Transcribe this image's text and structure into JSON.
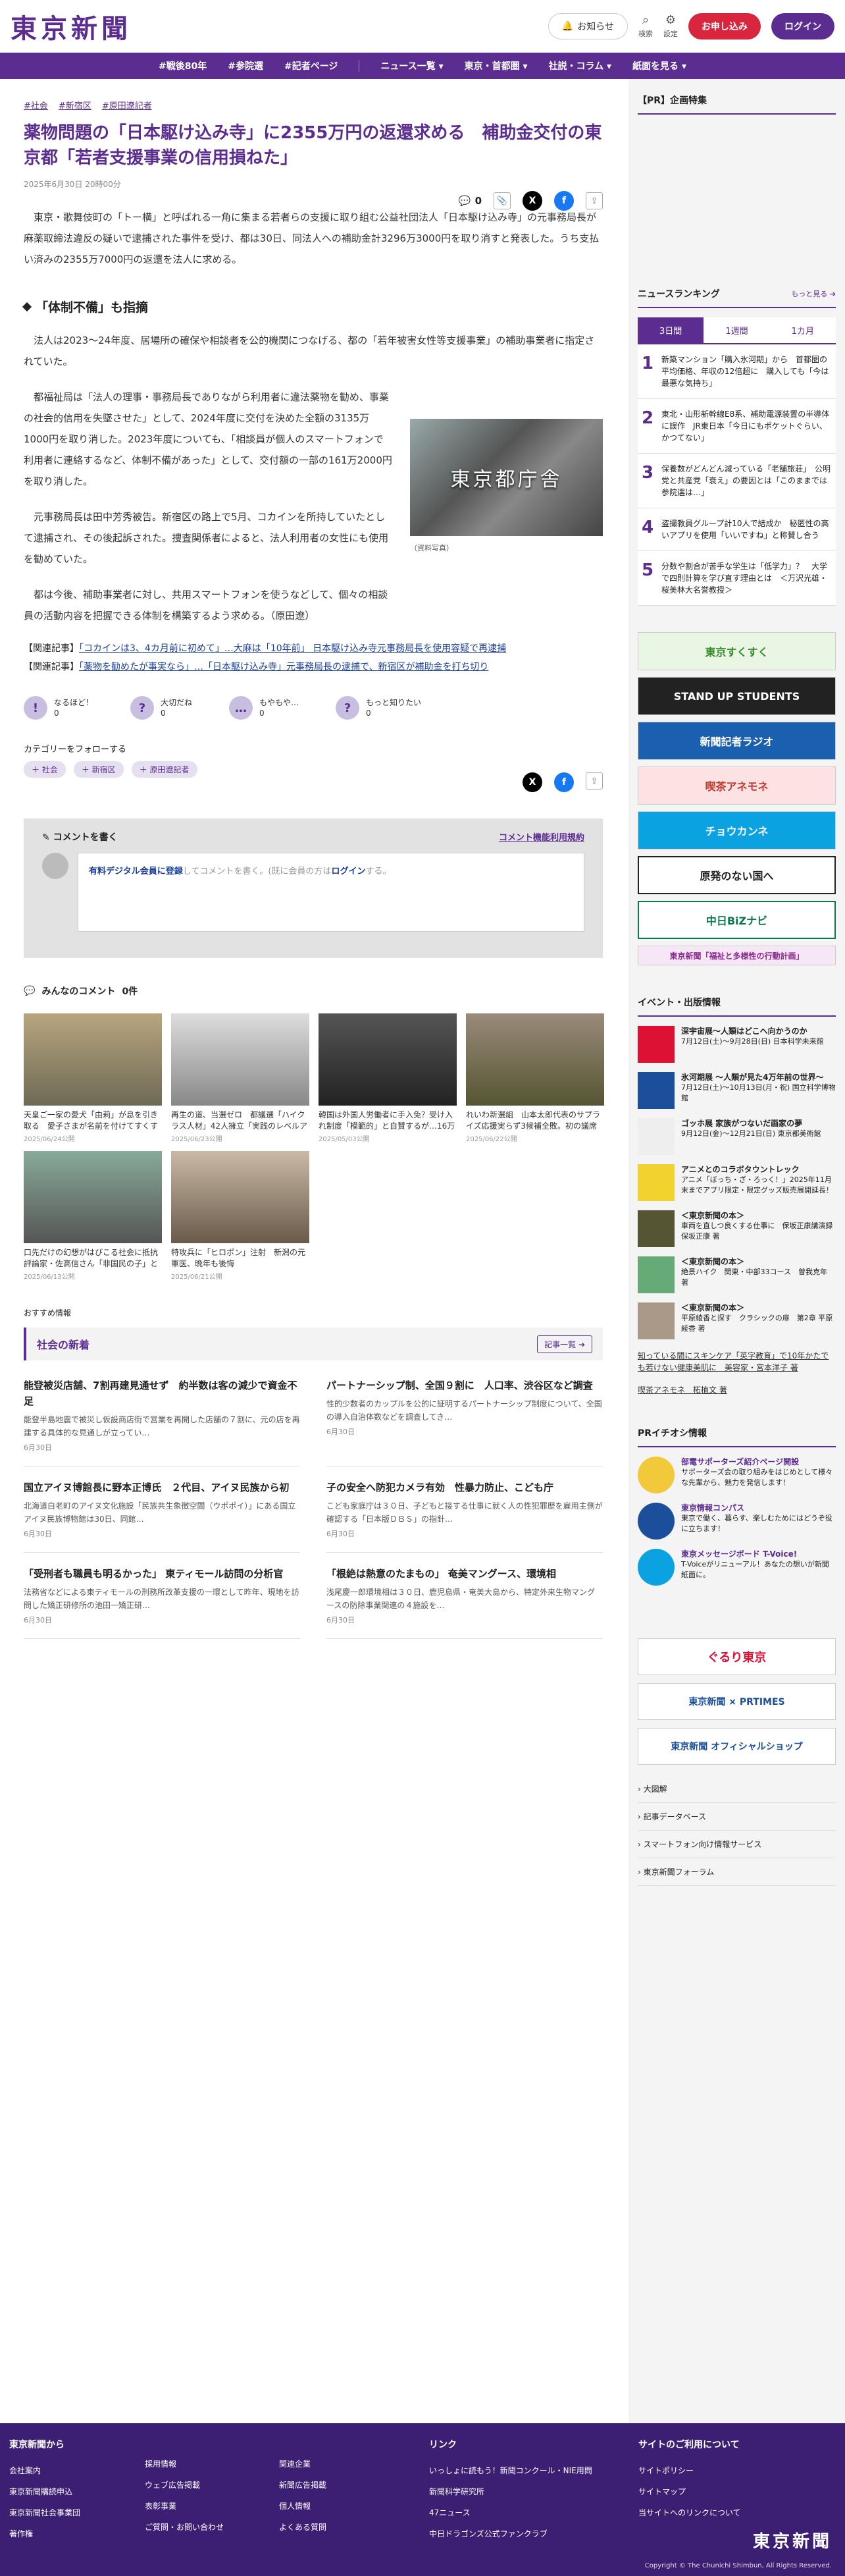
{
  "header": {
    "logo": "東京新聞",
    "notice": "お知らせ",
    "search": "検索",
    "settings": "設定",
    "register": "お申し込み",
    "login": "ログイン"
  },
  "nav": [
    "#戦後80年",
    "#参院選",
    "#記者ページ",
    "ニュース一覧",
    "東京・首都圏",
    "社説・コラム",
    "紙面を見る"
  ],
  "article": {
    "tags": [
      "#社会",
      "#新宿区",
      "#原田遼記者"
    ],
    "title": "薬物問題の「日本駆け込み寺」に2355万円の返還求める　補助金交付の東京都「若者支援事業の信用損ねた」",
    "date": "2025年6月30日 20時00分",
    "comment_count": "0",
    "p1": "東京・歌舞伎町の「トー横」と呼ばれる一角に集まる若者らの支援に取り組む公益社団法人「日本駆け込み寺」の元事務局長が麻薬取締法違反の疑いで逮捕された事件を受け、都は30日、同法人への補助金計3296万3000円を取り消すと発表した。うち支払い済みの2355万7000円の返還を法人に求める。",
    "sub": "「体制不備」も指摘",
    "p2": "法人は2023〜24年度、居場所の確保や相談者を公的機関につなげる、都の「若年被害女性等支援事業」の補助事業者に指定されていた。",
    "p3": "都福祉局は「法人の理事・事務局長でありながら利用者に違法薬物を勧め、事業の社会的信用を失墜させた」として、2024年度に交付を決めた全額の3135万1000円を取り消した。2023年度についても、「相談員が個人のスマートフォンで利用者に連絡するなど、体制不備があった」として、交付額の一部の161万2000円を取り消した。",
    "p4": "元事務局長は田中芳秀被告。新宿区の路上で5月、コカインを所持していたとして逮捕され、その後起訴された。捜査関係者によると、法人利用者の女性にも使用を勧めていた。",
    "p5": "都は今後、補助事業者に対し、共用スマートフォンを使うなどして、個々の相談員の活動内容を把握できる体制を構築するよう求める。（原田遼）",
    "fig_text": "東京都庁舎",
    "fig_caption": "（資料写真）",
    "rel_label": "【関連記事】",
    "rel1": "「コカインは3、4カ月前に初めて」…大麻は「10年前」 日本駆け込み寺元事務局長を使用容疑で再逮捕",
    "rel2": "「薬物を勧めたが事実なら」…「日本駆け込み寺」元事務局長の逮捕で、新宿区が補助金を打ち切り",
    "reactions": [
      {
        "icon": "!",
        "label": "なるほど！",
        "count": "0"
      },
      {
        "icon": "?",
        "label": "大切だね",
        "count": "0"
      },
      {
        "icon": "…",
        "label": "もやもや…",
        "count": "0"
      },
      {
        "icon": "?",
        "label": "もっと知りたい",
        "count": "0"
      }
    ],
    "follow_label": "カテゴリーをフォローする",
    "follow_tags": [
      "社会",
      "新宿区",
      "原田遼記者"
    ]
  },
  "comments": {
    "write": "コメントを書く",
    "rules": "コメント機能利用規約",
    "cta_pre": "有料デジタル会員に登録",
    "cta_mid": "してコメントを書く。(既に会員の方は",
    "cta_login": "ログイン",
    "cta_post": "する。",
    "all": "みんなのコメント",
    "count": "0件"
  },
  "cards": [
    {
      "t": "天皇ご一家の愛犬「由莉」が息を引き取る　愛子さまが名前を付けてすくすくと…16歳",
      "d": "2025/06/24公開"
    },
    {
      "t": "再生の道、当選ゼロ　都議選「ハイクラス人材」42人擁立「実践のレベルアップ手塚な…",
      "d": "2025/06/23公開"
    },
    {
      "t": "韓国は外国人労働者に手入免？受け入れ制度「模範的」と自賛するが…16万5000人の枠が手…",
      "d": "2025/05/03公開"
    },
    {
      "t": "れいわ新選組　山本太郎代表のサプライズ応援実らず3候補全敗。初の議席獲得ならず　東…",
      "d": "2025/06/22公開"
    },
    {
      "t": "口先だけの幻想がはびこる社会に抵抗　評論家・佐高信さん「非国民の子」として　利益…",
      "d": "2025/06/13公開"
    },
    {
      "t": "特攻兵に「ヒロポン」注射　新潟の元軍医、晩年も後悔",
      "d": "2025/06/21公開"
    }
  ],
  "recommend": "おすすめ情報",
  "social": {
    "title": "社会の新着",
    "more": "記事一覧",
    "items": [
      {
        "h": "能登被災店舗、7割再建見通せず　約半数は客の減少で資金不足",
        "s": "能登半島地震で被災し仮設商店街で営業を再開した店舗の７割に、元の店を再建する具体的な見通しが立ってい…",
        "d": "6月30日"
      },
      {
        "h": "パートナーシップ制、全国９割に　人口率、渋谷区など調査",
        "s": "性的少数者のカップルを公的に証明するパートナーシップ制度について、全国の導入自治体数などを調査してき…",
        "d": "6月30日"
      },
      {
        "h": "国立アイヌ博館長に野本正博氏　２代目、アイヌ民族から初",
        "s": "北海道白老町のアイヌ文化施設「民族共生象徴空間（ウポポイ）」にある国立アイヌ民族博物館は30日、同館…",
        "d": "6月30日"
      },
      {
        "h": "子の安全へ防犯カメラ有効　性暴力防止、こども庁",
        "s": "こども家庭庁は３０日、子どもと接する仕事に就く人の性犯罪歴を雇用主側が確認する「日本版ＤＢＳ」の指針…",
        "d": "6月30日"
      },
      {
        "h": "「受刑者も職員も明るかった」 東ティモール訪問の分析官",
        "s": "法務省などによる東ティモールの刑務所改革支援の一環として昨年、現地を訪問した矯正研修所の池田一矯正研…",
        "d": "6月30日"
      },
      {
        "h": "「根絶は熱意のたまもの」 奄美マングース、環境相",
        "s": "浅尾慶一郎環境相は３０日、鹿児島県・奄美大島から、特定外来生物マングースの防除事業関連の４施設を…",
        "d": "6月30日"
      }
    ]
  },
  "side": {
    "pr": "【PR】企画特集",
    "ranking": "ニュースランキング",
    "rank_more": "もっと見る",
    "tabs": [
      "3日間",
      "1週間",
      "1カ月"
    ],
    "rank": [
      {
        "n": "1",
        "t": "新築マンション「購入氷河期」から　首都圏の平均価格、年収の12倍超に　購入しても「今は最悪な気持ち」"
      },
      {
        "n": "2",
        "t": "東北・山形新幹線E8系、補助電源装置の半導体に誤作　JR東日本「今日にもポケットぐらい、かつてない」"
      },
      {
        "n": "3",
        "t": "保養数がどんどん減っている「老舗旅荘」　公明党と共産党「衰え」の要因とは「このままでは参院選は…」"
      },
      {
        "n": "4",
        "t": "盗撮教員グループ計10人で結成か　秘匿性の高いアプリを使用「いいですね」と称賛し合う"
      },
      {
        "n": "5",
        "t": "分数や割合が苦手な学生は「低学力」？　大学で四則計算を学び直す理由とは　＜万沢光雄・桜美林大名誉教授＞"
      }
    ],
    "banners": [
      "東京すくすく",
      "STAND UP STUDENTS",
      "新聞記者ラジオ",
      "喫茶アネモネ",
      "チョウカンネ",
      "原発のない国へ",
      "中日BiZナビ",
      "東京新聞「福祉と多様性の行動計画」"
    ],
    "events_h": "イベント・出版情報",
    "events": [
      {
        "t": "深宇宙展〜人類はどこへ向かうのか",
        "s": "7月12日(土)〜9月28日(日) 日本科学未来館"
      },
      {
        "t": "氷河期展 〜人類が見た4万年前の世界〜",
        "s": "7月12日(土)〜10月13日(月・祝) 国立科学博物館"
      },
      {
        "t": "ゴッホ展 家族がつないだ画家の夢",
        "s": "9月12日(金)〜12月21日(日) 東京都美術館"
      },
      {
        "t": "アニメとのコラボタウントレック",
        "s": "アニメ「ぼっち・ざ・ろっく！」2025年11月末までアプリ限定・限定グッズ販売展開延長！"
      },
      {
        "t": "＜東京新聞の本＞",
        "s": "車両を直しつ良くする仕事に　保坂正康講演録　保坂正康 著"
      },
      {
        "t": "＜東京新聞の本＞",
        "s": "絶景ハイク　関東・中部33コース　曽我克年 著"
      },
      {
        "t": "＜東京新聞の本＞",
        "s": "平原綾香と探す　クラシックの扉　第2章 平原綾香 著"
      }
    ],
    "side_link1": "知っている間にスキンケア「英字教育」で10年かたでも若けない健康美肌に　美容家・宮本洋子 著",
    "side_link2": "喫茶アネモネ　柘植文 著",
    "pr2_h": "PRイチオシ情報",
    "pr2": [
      {
        "t": "部電サポーターズ紹介ページ開設",
        "s": "サポーターズ会の取り組みをはじめとして様々な先輩から、魅力を発信します！"
      },
      {
        "t": "東京情報コンパス",
        "s": "東京で働く、暮らす、楽しむためにはどうぞ役に立ちます！"
      },
      {
        "t": "東京メッセージボード T-Voice!",
        "s": "T-Voiceがリニューアル！あなたの想いが新聞紙面に。"
      }
    ],
    "bn2": [
      "ぐるり東京",
      "東京新聞 × PRTIMES",
      "東京新聞 オフィシャルショップ"
    ],
    "menu": [
      "大図解",
      "記事データベース",
      "スマートフォン向け情報サービス",
      "東京新聞フォーラム"
    ]
  },
  "footer": {
    "c1h": "東京新聞から",
    "c1": [
      "会社案内",
      "東京新聞購読申込",
      "東京新聞社会事業団",
      "著作権"
    ],
    "c1b": [
      "採用情報",
      "ウェブ広告掲載",
      "表彰事業",
      "ご質問・お問い合わせ"
    ],
    "c1c": [
      "関連企業",
      "新聞広告掲載",
      "個人情報",
      "よくある質問"
    ],
    "c2h": "リンク",
    "c2": [
      "いっしょに読もう！新聞コンクール・NIE用問",
      "新聞科学研究所",
      "47ニュース",
      "中日ドラゴンズ公式ファンクラブ"
    ],
    "c3h": "サイトのご利用について",
    "c3": [
      "サイトポリシー",
      "サイトマップ",
      "当サイトへのリンクについて"
    ],
    "logo": "東京新聞",
    "copy": "Copyright © The Chunichi Shimbun, All Rights Reserved."
  }
}
